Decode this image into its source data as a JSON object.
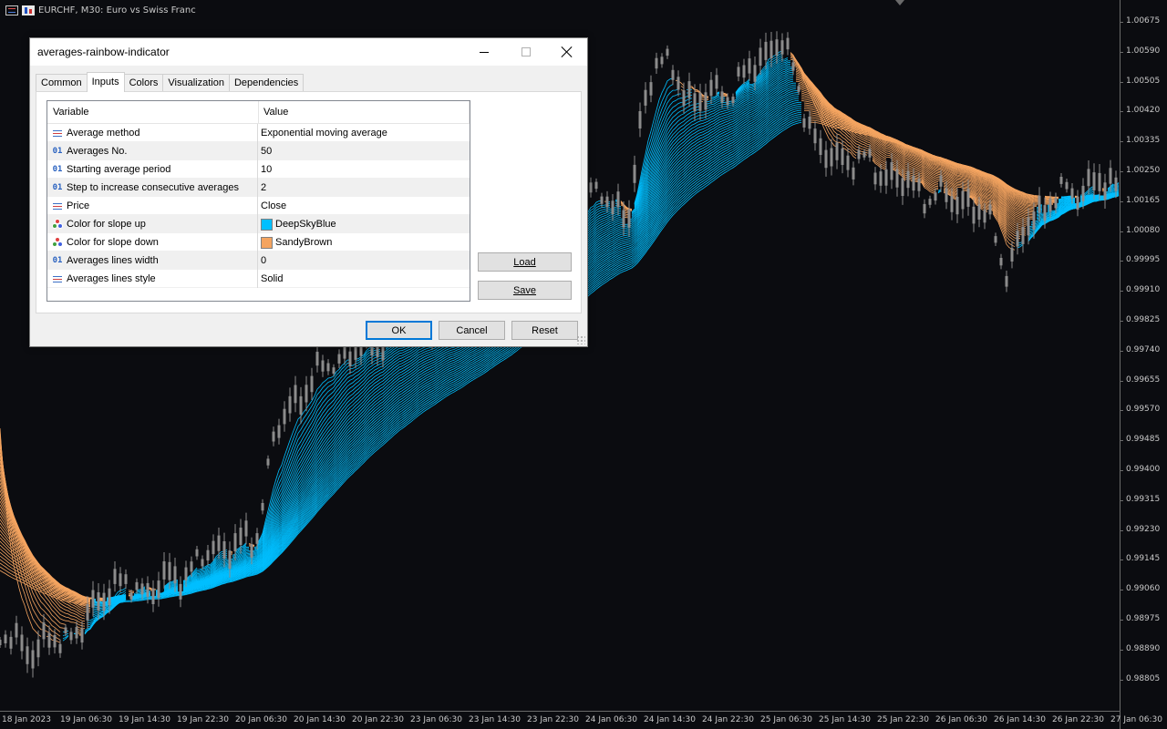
{
  "chart": {
    "title": "EURCHF, M30:  Euro vs Swiss Franc",
    "price_labels": [
      "1.00675",
      "1.00590",
      "1.00505",
      "1.00420",
      "1.00335",
      "1.00250",
      "1.00165",
      "1.00080",
      "0.99995",
      "0.99910",
      "0.99825",
      "0.99740",
      "0.99655",
      "0.99570",
      "0.99485",
      "0.99400",
      "0.99315",
      "0.99230",
      "0.99145",
      "0.99060",
      "0.98975",
      "0.98890",
      "0.98805"
    ],
    "time_labels": [
      "18 Jan 2023",
      "19 Jan 06:30",
      "19 Jan 14:30",
      "19 Jan 22:30",
      "20 Jan 06:30",
      "20 Jan 14:30",
      "20 Jan 22:30",
      "23 Jan 06:30",
      "23 Jan 14:30",
      "23 Jan 22:30",
      "24 Jan 06:30",
      "24 Jan 14:30",
      "24 Jan 22:30",
      "25 Jan 06:30",
      "25 Jan 14:30",
      "25 Jan 22:30",
      "26 Jan 06:30",
      "26 Jan 14:30",
      "26 Jan 22:30",
      "27 Jan 06:30"
    ],
    "colors": {
      "slope_up": "#00bfff",
      "slope_down": "#f4a460",
      "candles": "#8c8c8c",
      "background": "#0b0c10"
    }
  },
  "dialog": {
    "title": "averages-rainbow-indicator",
    "tabs": [
      "Common",
      "Inputs",
      "Colors",
      "Visualization",
      "Dependencies"
    ],
    "active_tab": "Inputs",
    "columns": {
      "variable": "Variable",
      "value": "Value"
    },
    "params": [
      {
        "name": "Average method",
        "value": "Exponential moving average",
        "icon": "enum-icon"
      },
      {
        "name": "Averages No.",
        "value": "50",
        "icon": "int-icon"
      },
      {
        "name": "Starting average period",
        "value": "10",
        "icon": "int-icon"
      },
      {
        "name": "Step to increase consecutive averages",
        "value": "2",
        "icon": "int-icon"
      },
      {
        "name": "Price",
        "value": "Close",
        "icon": "enum-icon"
      },
      {
        "name": "Color for slope up",
        "value": "DeepSkyBlue",
        "icon": "color-icon",
        "swatch": "#00bfff"
      },
      {
        "name": "Color for slope down",
        "value": "SandyBrown",
        "icon": "color-icon",
        "swatch": "#f4a460"
      },
      {
        "name": "Averages lines width",
        "value": "0",
        "icon": "int-icon"
      },
      {
        "name": "Averages lines style",
        "value": "Solid",
        "icon": "enum-icon"
      }
    ],
    "int_icon_text": "01",
    "buttons": {
      "load": "Load",
      "save": "Save",
      "ok": "OK",
      "cancel": "Cancel",
      "reset": "Reset"
    }
  }
}
